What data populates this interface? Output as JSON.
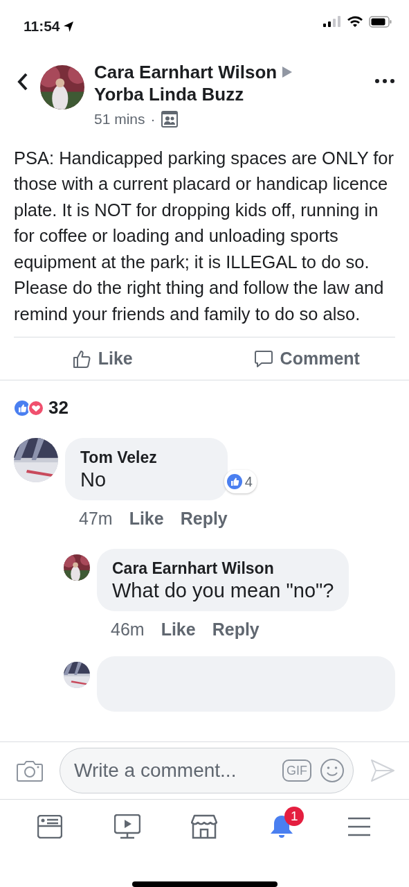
{
  "status_bar": {
    "time": "11:54"
  },
  "post": {
    "author": "Cara Earnhart Wilson",
    "group": "Yorba Linda Buzz",
    "time": "51 mins",
    "separator": "·",
    "text": "PSA: Handicapped parking spaces are ONLY for those with a current placard or handicap licence plate.  It is NOT for dropping kids off, running in for coffee or loading and unloading sports equipment at the park; it is ILLEGAL to do so. Please do the right thing and follow the law and remind your friends and family to do so also."
  },
  "actions": [
    {
      "kind": "like",
      "label": "Like"
    },
    {
      "kind": "comment",
      "label": "Comment"
    }
  ],
  "reactions": {
    "count": "32"
  },
  "comments": [
    {
      "kind": "full",
      "author": "Tom Velez",
      "text": "No",
      "reaction_count": "4",
      "time": "47m",
      "like": "Like",
      "reply": "Reply",
      "children": [
        {
          "kind": "full",
          "author": "Cara Earnhart Wilson",
          "text": "What do you mean \"no\"?",
          "time": "46m",
          "like": "Like",
          "reply": "Reply"
        },
        {
          "kind": "cut_off"
        }
      ]
    }
  ],
  "composer": {
    "placeholder": "Write a comment...",
    "gif_label": "GIF"
  },
  "tabs": [
    {
      "kind": "feed",
      "selected": false
    },
    {
      "kind": "watch",
      "selected": false
    },
    {
      "kind": "marketplace",
      "selected": false
    },
    {
      "kind": "notifications",
      "selected": true,
      "badge": "1"
    },
    {
      "kind": "menu",
      "selected": false
    }
  ]
}
